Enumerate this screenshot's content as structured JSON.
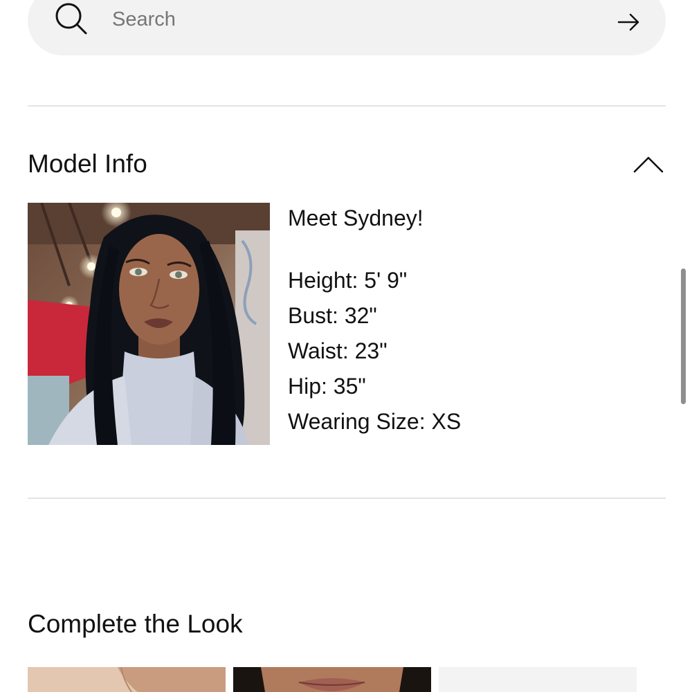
{
  "search": {
    "placeholder": "Search",
    "value": ""
  },
  "model_info": {
    "title": "Model Info",
    "expanded": true,
    "intro": "Meet Sydney!",
    "stats": [
      "Height: 5' 9\"",
      "Bust: 32\"",
      "Waist: 23\"",
      "Hip: 35\"",
      "Wearing Size: XS"
    ]
  },
  "complete_the_look": {
    "title": "Complete the Look"
  },
  "icons": {
    "search": "search-icon",
    "submit": "arrow-right-icon",
    "collapse": "chevron-up-icon"
  },
  "colors": {
    "search_bg": "#f2f2f2",
    "divider": "#e4e4e4",
    "text": "#111111",
    "placeholder": "#767676"
  }
}
